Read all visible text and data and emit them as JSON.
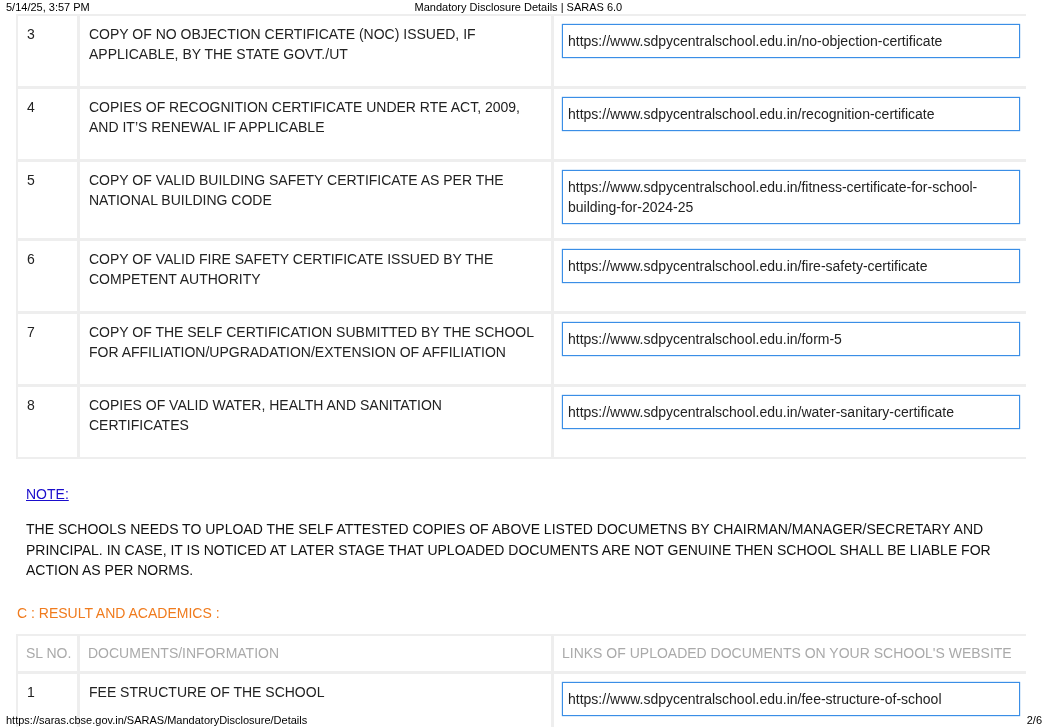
{
  "header": {
    "datetime": "5/14/25, 3:57 PM",
    "title": "Mandatory Disclosure Details | SARAS 6.0"
  },
  "documents_table": {
    "rows": [
      {
        "sl_no": "3",
        "document": "COPY OF NO OBJECTION CERTIFICATE (NOC) ISSUED, IF APPLICABLE, BY THE STATE GOVT./UT",
        "link": "https://www.sdpycentralschool.edu.in/no-objection-certificate"
      },
      {
        "sl_no": "4",
        "document": "COPIES OF RECOGNITION CERTIFICATE UNDER RTE ACT, 2009, AND IT’S RENEWAL IF APPLICABLE",
        "link": "https://www.sdpycentralschool.edu.in/recognition-certificate"
      },
      {
        "sl_no": "5",
        "document": "COPY OF VALID BUILDING SAFETY CERTIFICATE AS PER THE NATIONAL BUILDING CODE",
        "link": "https://www.sdpycentralschool.edu.in/fitness-certificate-for-school-building-for-2024-25"
      },
      {
        "sl_no": "6",
        "document": "COPY OF VALID FIRE SAFETY CERTIFICATE ISSUED BY THE COMPETENT AUTHORITY",
        "link": "https://www.sdpycentralschool.edu.in/fire-safety-certificate"
      },
      {
        "sl_no": "7",
        "document": "COPY OF THE SELF CERTIFICATION SUBMITTED BY THE SCHOOL FOR AFFILIATION/UPGRADATION/EXTENSION OF AFFILIATION",
        "link": "https://www.sdpycentralschool.edu.in/form-5"
      },
      {
        "sl_no": "8",
        "document": "COPIES OF VALID WATER, HEALTH AND SANITATION CERTIFICATES",
        "link": "https://www.sdpycentralschool.edu.in/water-sanitary-certificate"
      }
    ]
  },
  "note": {
    "link": "NOTE:",
    "text": "THE SCHOOLS NEEDS TO UPLOAD THE SELF ATTESTED COPIES OF ABOVE LISTED DOCUMETNS BY CHAIRMAN/MANAGER/SECRETARY AND PRINCIPAL. IN CASE, IT IS NOTICED AT LATER STAGE THAT UPLOADED DOCUMENTS ARE NOT GENUINE THEN SCHOOL SHALL BE LIABLE FOR ACTION AS PER NORMS."
  },
  "section_c": {
    "heading": "C : RESULT AND ACADEMICS :",
    "table": {
      "columns": [
        "SL NO.",
        "DOCUMENTS/INFORMATION",
        "LINKS OF UPLOADED DOCUMENTS ON YOUR SCHOOL'S WEBSITE"
      ],
      "rows": [
        {
          "sl_no": "1",
          "document": "FEE STRUCTURE OF THE SCHOOL",
          "link": "https://www.sdpycentralschool.edu.in/fee-structure-of-school"
        }
      ]
    }
  },
  "footer": {
    "url": "https://saras.cbse.gov.in/SARAS/MandatoryDisclosure/Details",
    "page": "2/6"
  }
}
